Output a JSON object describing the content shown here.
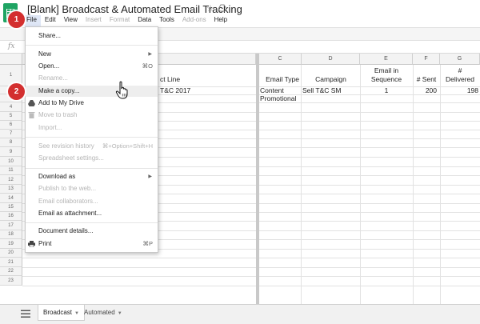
{
  "app": {
    "title": "[Blank] Broadcast & Automated Email Tracking",
    "star_icon": "star-icon",
    "drive_icon": "drive-icon"
  },
  "menubar": [
    "File",
    "Edit",
    "View",
    "Insert",
    "Format",
    "Data",
    "Tools",
    "Add-ons",
    "Help"
  ],
  "menubar_disabled": [
    "Insert",
    "Format",
    "Add-ons"
  ],
  "formula_bar": {
    "fx_label": "fx"
  },
  "columns": {
    "b": "B",
    "c": "C",
    "d": "D",
    "e": "E",
    "f": "F",
    "g": "G"
  },
  "rows": [
    "1",
    "2",
    "3",
    "4",
    "5",
    "6",
    "7",
    "8",
    "9",
    "10",
    "11",
    "12",
    "13",
    "14",
    "15",
    "16",
    "17",
    "18",
    "19",
    "20",
    "21",
    "22",
    "23"
  ],
  "cells": {
    "b1_partial": "ct Line",
    "b2_partial": "T&C 2017",
    "c1": "Email Type",
    "d1": "Campaign",
    "e1_line1": "Email in",
    "e1_line2": "Sequence",
    "f1": "# Sent",
    "g1_line1": "#",
    "g1_line2": "Delivered",
    "c2": "Content",
    "d2": "Sell T&C SM",
    "e2": "1",
    "f2": "200",
    "g2_partial": "198",
    "c3": "Promotional"
  },
  "file_menu": {
    "share": "Share...",
    "new": "New",
    "open": "Open...",
    "open_shortcut": "⌘O",
    "rename": "Rename...",
    "make_copy": "Make a copy...",
    "add_to_drive": "Add to My Drive",
    "move_to_trash": "Move to trash",
    "import": "Import...",
    "revision_history": "See revision history",
    "revision_shortcut": "⌘+Option+Shift+H",
    "spreadsheet_settings": "Spreadsheet settings...",
    "download_as": "Download as",
    "publish": "Publish to the web...",
    "email_collaborators": "Email collaborators...",
    "email_attachment": "Email as attachment...",
    "document_details": "Document details...",
    "print": "Print",
    "print_shortcut": "⌘P"
  },
  "tabs": {
    "broadcast": "Broadcast",
    "automated": "Automated"
  },
  "callouts": {
    "one": "1",
    "two": "2"
  },
  "colors": {
    "brand_green": "#1fa463",
    "callout_red": "#d32f2f",
    "menu_hover": "#eeeeee"
  }
}
